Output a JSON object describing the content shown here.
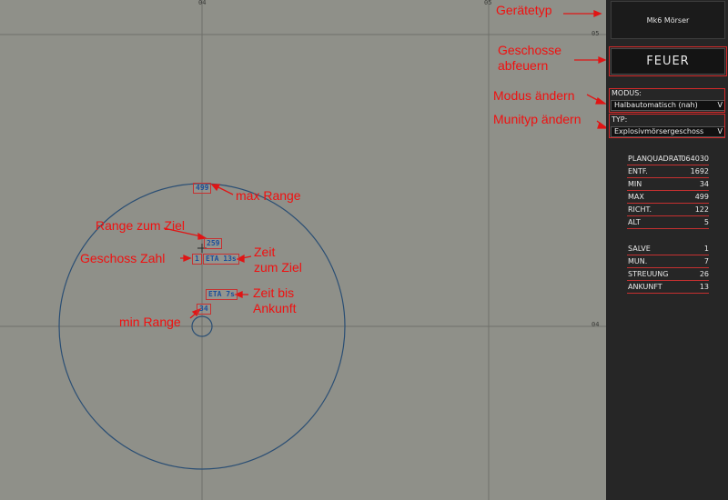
{
  "map": {
    "grid_labels": {
      "top_left": "04",
      "top_right": "05",
      "right_upper": "05",
      "right_lower": "04"
    },
    "markers": {
      "max_range": "499",
      "target_range": "259",
      "projectile_count": "1",
      "eta_target": "ETA 13s",
      "eta_arrival": "ETA 7s",
      "min_range": "34"
    },
    "colors": {
      "background": "#8f9089",
      "circle": "#2a4e74",
      "grid": "#6f706b"
    }
  },
  "annotations": {
    "device_type": "Gerätetyp",
    "fire": "Geschosse\nabfeuern",
    "mode": "Modus ändern",
    "ammo": "Munityp ändern",
    "max_range": "max Range",
    "range_to_target": "Range zum Ziel",
    "projectile_count": "Geschoss Zahl",
    "time_to_target": "Zeit\nzum Ziel",
    "time_to_arrival": "Zeit bis\nAnkunft",
    "min_range": "min Range"
  },
  "panel": {
    "device_name": "Mk6 Mörser",
    "fire_label": "FEUER",
    "mode_label": "MODUS:",
    "mode_value": "Halbautomatisch (nah)",
    "type_label": "TYP:",
    "type_value": "Explosivmörsergeschoss",
    "chevron": "V",
    "stats": [
      {
        "key": "PLANQUADRAT",
        "value": "064030"
      },
      {
        "key": "ENTF.",
        "value": "1692"
      },
      {
        "key": "MIN",
        "value": "34"
      },
      {
        "key": "MAX",
        "value": "499"
      },
      {
        "key": "RICHT.",
        "value": "122"
      },
      {
        "key": "ALT",
        "value": "5"
      }
    ],
    "stats2": [
      {
        "key": "SALVE",
        "value": "1"
      },
      {
        "key": "MUN.",
        "value": "7"
      },
      {
        "key": "STREUUNG",
        "value": "26"
      },
      {
        "key": "ANKUNFT",
        "value": "13"
      }
    ]
  }
}
